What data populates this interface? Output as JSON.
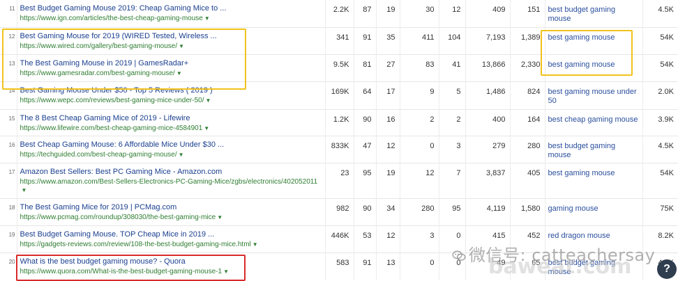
{
  "rows": [
    {
      "rank": "11",
      "title": "Best Budget Gaming Mouse 2019: Cheap Gaming Mice to ...",
      "url": "https://www.ign.com/articles/the-best-cheap-gaming-mouse",
      "c1": "2.2K",
      "c2": "87",
      "c3": "19",
      "c4": "30",
      "c5": "12",
      "c6": "409",
      "c7": "151",
      "keyword": "best budget gaming mouse",
      "volume": "4.5K"
    },
    {
      "rank": "12",
      "title": "Best Gaming Mouse for 2019 (WIRED Tested, Wireless ...",
      "url": "https://www.wired.com/gallery/best-gaming-mouse/",
      "c1": "341",
      "c2": "91",
      "c3": "35",
      "c4": "411",
      "c5": "104",
      "c6": "7,193",
      "c7": "1,389",
      "keyword": "best gaming mouse",
      "volume": "54K"
    },
    {
      "rank": "13",
      "title": "The Best Gaming Mouse in 2019 | GamesRadar+",
      "url": "https://www.gamesradar.com/best-gaming-mouse/",
      "c1": "9.5K",
      "c2": "81",
      "c3": "27",
      "c4": "83",
      "c5": "41",
      "c6": "13,866",
      "c7": "2,330",
      "keyword": "best gaming mouse",
      "volume": "54K"
    },
    {
      "rank": "14",
      "title": "Best Gaming Mouse Under $50 - Top 5 Reviews ( 2019 )",
      "url": "https://www.wepc.com/reviews/best-gaming-mice-under-50/",
      "c1": "169K",
      "c2": "64",
      "c3": "17",
      "c4": "9",
      "c5": "5",
      "c6": "1,486",
      "c7": "824",
      "keyword": "best gaming mouse under 50",
      "volume": "2.0K"
    },
    {
      "rank": "15",
      "title": "The 8 Best Cheap Gaming Mice of 2019 - Lifewire",
      "url": "https://www.lifewire.com/best-cheap-gaming-mice-4584901",
      "c1": "1.2K",
      "c2": "90",
      "c3": "16",
      "c4": "2",
      "c5": "2",
      "c6": "400",
      "c7": "164",
      "keyword": "best cheap gaming mouse",
      "volume": "3.9K"
    },
    {
      "rank": "16",
      "title": "Best Cheap Gaming Mouse: 6 Affordable Mice Under $30 ...",
      "url": "https://techguided.com/best-cheap-gaming-mouse/",
      "c1": "833K",
      "c2": "47",
      "c3": "12",
      "c4": "0",
      "c5": "3",
      "c6": "279",
      "c7": "280",
      "keyword": "best budget gaming mouse",
      "volume": "4.5K"
    },
    {
      "rank": "17",
      "title": "Amazon Best Sellers: Best PC Gaming Mice - Amazon.com",
      "url": "https://www.amazon.com/Best-Sellers-Electronics-PC-Gaming-Mice/zgbs/electronics/402052011",
      "c1": "23",
      "c2": "95",
      "c3": "19",
      "c4": "12",
      "c5": "7",
      "c6": "3,837",
      "c7": "405",
      "keyword": "best gaming mouse",
      "volume": "54K"
    },
    {
      "rank": "18",
      "title": "The Best Gaming Mice for 2019 | PCMag.com",
      "url": "https://www.pcmag.com/roundup/308030/the-best-gaming-mice",
      "c1": "982",
      "c2": "90",
      "c3": "34",
      "c4": "280",
      "c5": "95",
      "c6": "4,119",
      "c7": "1,580",
      "keyword": "gaming mouse",
      "volume": "75K"
    },
    {
      "rank": "19",
      "title": "Best Budget Gaming Mouse. TOP Cheap Mice in 2019 ...",
      "url": "https://gadgets-reviews.com/review/108-the-best-budget-gaming-mice.html",
      "c1": "446K",
      "c2": "53",
      "c3": "12",
      "c4": "3",
      "c5": "0",
      "c6": "415",
      "c7": "452",
      "keyword": "red dragon mouse",
      "volume": "8.2K"
    },
    {
      "rank": "20",
      "title": "What is the best budget gaming mouse? - Quora",
      "url": "https://www.quora.com/What-is-the-best-budget-gaming-mouse-1",
      "c1": "583",
      "c2": "91",
      "c3": "13",
      "c4": "0",
      "c5": "0",
      "c6": "49",
      "c7": "65",
      "keyword": "best budget gaming mouse",
      "volume": "4.5K"
    }
  ],
  "watermark": {
    "text": "微信号: catteachersay",
    "text2": "baweat.com"
  },
  "help_label": "?",
  "caret": "▼"
}
